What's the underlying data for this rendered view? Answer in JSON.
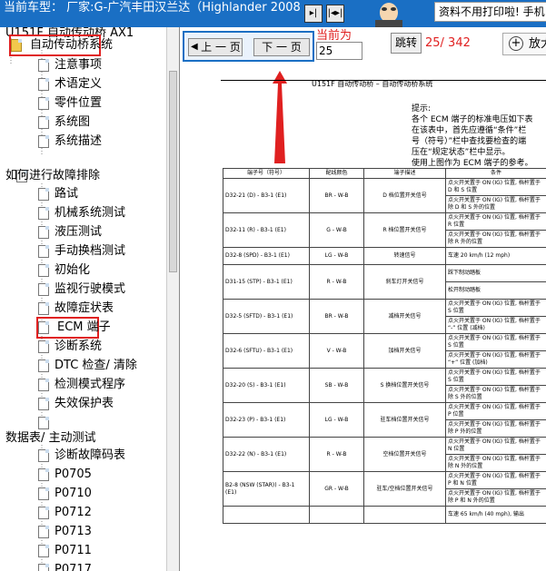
{
  "header": {
    "car_label": "当前车型： 厂家:G-广汽丰田汉兰达（Highlander 2008",
    "banner": "资料不用打印啦! 手机"
  },
  "tree": {
    "root": "U151F 自动传动桥 AX1",
    "folder": "自动传动桥系统",
    "sys_items": [
      "注意事项",
      "术语定义",
      "零件位置",
      "系统图",
      "系统描述"
    ],
    "group2": "如何进行故障排除",
    "diag_items": [
      "路试",
      "机械系统测试",
      "液压测试",
      "手动换档测试",
      "初始化",
      "监视行驶模式",
      "故障症状表",
      "ECM 端子",
      "诊断系统",
      "DTC 检查/ 清除",
      "检测模式程序",
      "失效保护表"
    ],
    "group3": "数据表/ 主动测试",
    "dtc_items": [
      "诊断故障码表",
      "P0705",
      "P0710",
      "P0712",
      "P0713",
      "P0711",
      "P0717"
    ]
  },
  "toolbar": {
    "prev": "上 一 页",
    "next": "下 一 页",
    "current_label": "当前为",
    "current_page": "25",
    "jump": "跳转",
    "page_count": "25/ 342",
    "zoom": "放大"
  },
  "doc": {
    "title": "U151F 自动传动桥 – 自动传动桥系统",
    "hint_title": "提示:",
    "hints": [
      "各个 ECM 端子的标准电压如下表",
      "在该表中，首先应遵循“条件”栏",
      "号（符号）”栏中查找要检查的端",
      "压在“规定状态”栏中显示。",
      "使用上图作为 ECM 端子的参考。"
    ],
    "headers": [
      "端子号（符号）",
      "配线颜色",
      "端子描述",
      "条件"
    ],
    "rows": [
      {
        "term": "D32-21 (D) - B3-1 (E1)",
        "color": "BR - W-B",
        "desc": "D 档位置开关信号",
        "conds": [
          "点火开关置于 ON (IG) 位置, 档杆置于 D 和 S 位置",
          "点火开关置于 ON (IG) 位置, 档杆置于除 D 和 S 外的位置"
        ]
      },
      {
        "term": "D32-11 (R) - B3-1 (E1)",
        "color": "G - W-B",
        "desc": "R 档位置开关信号",
        "conds": [
          "点火开关置于 ON (IG) 位置, 档杆置于 R 位置",
          "点火开关置于 ON (IG) 位置, 档杆置于除 R 外的位置"
        ]
      },
      {
        "term": "D32-8 (SPD) - B3-1 (E1)",
        "color": "LG - W-B",
        "desc": "转速信号",
        "conds": [
          "车速 20 km/h (12 mph)"
        ]
      },
      {
        "term": "D31-15 (STP) - B3-1 (E1)",
        "color": "R - W-B",
        "desc": "刹车灯开关信号",
        "conds": [
          "踩下制动踏板",
          "松开制动踏板"
        ]
      },
      {
        "term": "D32-5 (SFTD) - B3-1 (E1)",
        "color": "BR - W-B",
        "desc": "减档开关信号",
        "conds": [
          "点火开关置于 ON (IG) 位置, 档杆置于 S 位置",
          "点火开关置于 ON (IG) 位置, 档杆置于 “-” 位置 (减档)"
        ]
      },
      {
        "term": "D32-6 (SFTU) - B3-1 (E1)",
        "color": "V - W-B",
        "desc": "加档开关信号",
        "conds": [
          "点火开关置于 ON (IG) 位置, 档杆置于 S 位置",
          "点火开关置于 ON (IG) 位置, 档杆置于 “+” 位置 (加档)"
        ]
      },
      {
        "term": "D32-20 (S) - B3-1 (E1)",
        "color": "SB - W-B",
        "desc": "S 换档位置开关信号",
        "conds": [
          "点火开关置于 ON (IG) 位置, 档杆置于 S 位置",
          "点火开关置于 ON (IG) 位置, 档杆置于除 S 外的位置"
        ]
      },
      {
        "term": "D32-23 (P) - B3-1 (E1)",
        "color": "LG - W-B",
        "desc": "驻车档位置开关信号",
        "conds": [
          "点火开关置于 ON (IG) 位置, 档杆置于 P 位置",
          "点火开关置于 ON (IG) 位置, 档杆置于除 P 外的位置"
        ]
      },
      {
        "term": "D32-22 (N) - B3-1 (E1)",
        "color": "R - W-B",
        "desc": "空档位置开关信号",
        "conds": [
          "点火开关置于 ON (IG) 位置, 档杆置于 N 位置",
          "点火开关置于 ON (IG) 位置, 档杆置于除 N 外的位置"
        ]
      },
      {
        "term": "B2-8 (NSW (STAR)) - B3-1 (E1)",
        "color": "GR - W-B",
        "desc": "驻车/空档位置开关信号",
        "conds": [
          "点火开关置于 ON (IG) 位置, 档杆置于 P 和 N 位置",
          "点火开关置于 ON (IG) 位置, 档杆置于除 P 和 N 外的位置"
        ]
      },
      {
        "term": "",
        "color": "",
        "desc": "",
        "conds": [
          "车速 65 km/h (40 mph), 输出"
        ]
      }
    ]
  },
  "colors": {
    "header_bg": "#1a6fc4",
    "highlight": "#e02020"
  }
}
